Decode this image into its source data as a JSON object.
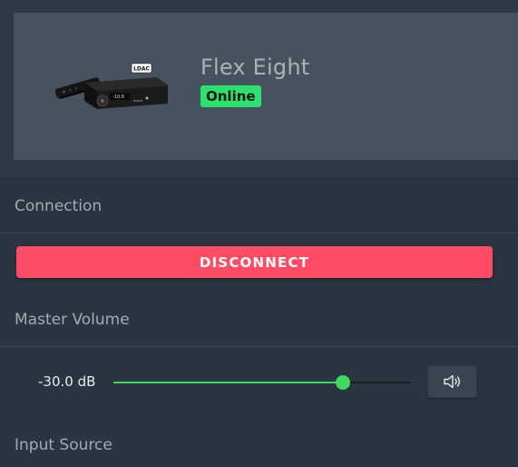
{
  "device": {
    "name": "Flex Eight",
    "status": "Online",
    "image_label": "LDAC"
  },
  "sections": {
    "connection": "Connection",
    "master_volume": "Master Volume",
    "input_source": "Input Source"
  },
  "connection": {
    "button_label": "DISCONNECT"
  },
  "volume": {
    "readout": "-30.0 dB",
    "level_fraction": 0.77
  },
  "icons": {
    "mute": "speaker-volume-icon"
  },
  "colors": {
    "accent_green": "#2fe06f",
    "disconnect_red": "#ff4b63",
    "slider_green": "#3fd95d"
  }
}
